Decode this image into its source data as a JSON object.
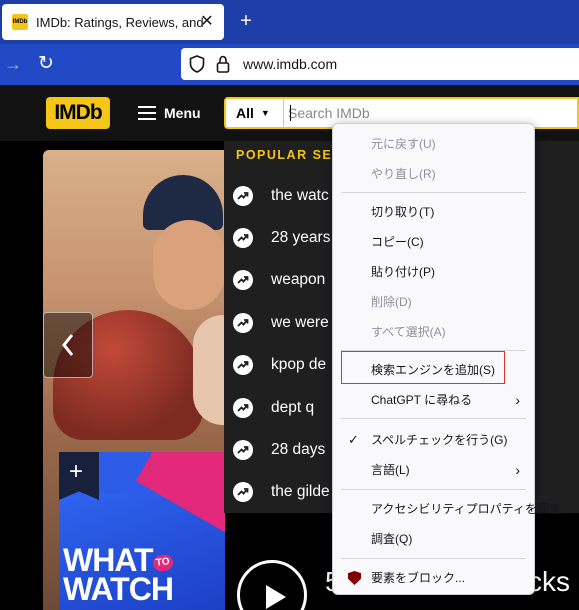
{
  "browser": {
    "tab_title": "IMDb: Ratings, Reviews, and Wh",
    "favicon_text": "IMDb",
    "tab_close": "✕",
    "new_tab": "+",
    "forward": "→",
    "reload": "↻",
    "url": "www.imdb.com"
  },
  "header": {
    "logo": "IMDb",
    "menu_label": "Menu",
    "search_category": "All",
    "search_placeholder": "Search IMDb"
  },
  "popular": {
    "heading": "POPULAR SEA",
    "items": [
      {
        "label": "the watc"
      },
      {
        "label": "28 years"
      },
      {
        "label": "weapon"
      },
      {
        "label": "we were"
      },
      {
        "label": "kpop de"
      },
      {
        "label": "dept q"
      },
      {
        "label": "28 days"
      },
      {
        "label": "the gilde"
      }
    ]
  },
  "context_menu": {
    "undo": "元に戻す(U)",
    "redo": "やり直し(R)",
    "cut": "切り取り(T)",
    "copy": "コピー(C)",
    "paste": "貼り付け(P)",
    "delete": "削除(D)",
    "select_all": "すべて選択(A)",
    "add_search_engine": "検索エンジンを追加(S)",
    "ask_chatgpt": "ChatGPT に尋ねる",
    "spellcheck": "スペルチェックを行う(G)",
    "languages": "言語(L)",
    "inspect_accessibility": "アクセシビリティプロパティを調査",
    "inspect": "調査(Q)",
    "block_element": "要素をブロック..."
  },
  "hero": {
    "poster_title_1": "WHAT",
    "poster_to": "TO",
    "poster_title_2": "WATCH",
    "trailer_number": "5",
    "trailer_text": "cks"
  },
  "colors": {
    "imdb_yellow": "#f5c518",
    "tabstrip_blue": "#1f3fa8",
    "navbar_blue": "#2249c6",
    "highlight_red": "#e0302f"
  }
}
